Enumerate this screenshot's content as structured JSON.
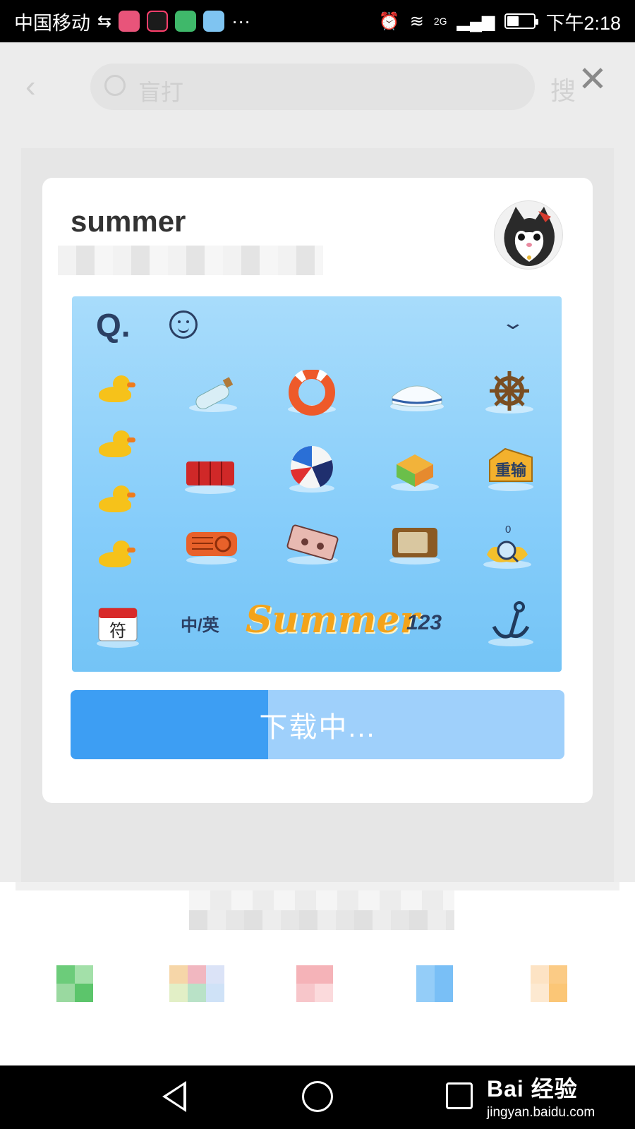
{
  "status_bar": {
    "carrier": "中国移动",
    "more": "···",
    "network": "2G",
    "time": "下午2:18"
  },
  "background": {
    "search_placeholder": "盲打",
    "search_button": "搜"
  },
  "dialog": {
    "title": "summer",
    "skin_preview": {
      "summer_label": "Summer",
      "lang_key": "中/英",
      "num_key": "123",
      "symbol_key": "符",
      "counter": "0"
    },
    "progress": {
      "label": "下载中...",
      "value": 0.4
    }
  },
  "watermark": {
    "brand": "Bai  经验",
    "url": "jingyan.baidu.com"
  }
}
